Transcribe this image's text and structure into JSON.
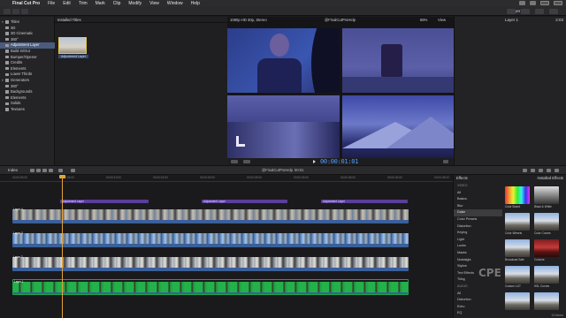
{
  "menubar": {
    "app_name": "Final Cut Pro",
    "menus": [
      "File",
      "Edit",
      "Trim",
      "Mark",
      "Clip",
      "Modify",
      "View",
      "Window",
      "Help"
    ]
  },
  "toolbar": {
    "right_label": "Layer 1"
  },
  "sidebar": {
    "items": [
      {
        "label": "Titles",
        "level": 0,
        "expanded": true,
        "selected": false
      },
      {
        "label": "3D",
        "level": 1,
        "selected": false
      },
      {
        "label": "3D Cinematic",
        "level": 1,
        "selected": false
      },
      {
        "label": "360°",
        "level": 1,
        "selected": false
      },
      {
        "label": "Adjustment Layer",
        "level": 1,
        "selected": true
      },
      {
        "label": "Build In/Out",
        "level": 1,
        "selected": false
      },
      {
        "label": "Bumper/Opener",
        "level": 1,
        "selected": false
      },
      {
        "label": "Credits",
        "level": 1,
        "selected": false
      },
      {
        "label": "Elements",
        "level": 1,
        "selected": false
      },
      {
        "label": "Lower Thirds",
        "level": 1,
        "selected": false
      },
      {
        "label": "Generators",
        "level": 0,
        "expanded": true,
        "selected": false
      },
      {
        "label": "360°",
        "level": 1,
        "selected": false
      },
      {
        "label": "Backgrounds",
        "level": 1,
        "selected": false
      },
      {
        "label": "Elements",
        "level": 1,
        "selected": false
      },
      {
        "label": "Solids",
        "level": 1,
        "selected": false
      },
      {
        "label": "Textures",
        "level": 1,
        "selected": false
      }
    ]
  },
  "browser": {
    "header": "Installed Titles",
    "clip_label": "Adjustment Layer"
  },
  "viewer": {
    "format": "1080p HD 30p, Stereo",
    "title": "@FinalCutProHelp",
    "zoom": "66%",
    "view_label": "View",
    "timecode": "00:00:01:01"
  },
  "inspector": {
    "title": "Layer 1",
    "time": "2:03"
  },
  "timeline_bar": {
    "index_label": "Index",
    "project": "@FinalCutProHelp",
    "duration": "00:01"
  },
  "timeline": {
    "ruler_ticks": [
      "00:00:00:00",
      "00:00:05:00",
      "00:00:10:00",
      "00:00:15:00",
      "00:00:20:00",
      "00:00:25:00",
      "00:00:30:00",
      "00:00:35:00",
      "00:00:40:00",
      "00:00:45:00",
      "00:00:50:00"
    ],
    "adjustment_clips": [
      "Adjustment Layer",
      "Adjustment Layer",
      "Adjustment Layer"
    ],
    "tracks": [
      {
        "name": "Layer 4",
        "style": "t-blue"
      },
      {
        "name": "Layer 3",
        "style": "t-mtn"
      },
      {
        "name": "Layer 2",
        "style": "t-car"
      },
      {
        "name": "Layer 1",
        "style": "t-green"
      }
    ]
  },
  "effects": {
    "categories_header": "Effects",
    "installed_header": "Installed Effects",
    "categories": [
      {
        "label": "VIDEO",
        "header": true
      },
      {
        "label": "All",
        "selected": false
      },
      {
        "label": "Basics",
        "selected": false
      },
      {
        "label": "Blur",
        "selected": false
      },
      {
        "label": "Color",
        "selected": true
      },
      {
        "label": "Color Presets",
        "selected": false
      },
      {
        "label": "Distortion",
        "selected": false
      },
      {
        "label": "Keying",
        "selected": false
      },
      {
        "label": "Light",
        "selected": false
      },
      {
        "label": "Looks",
        "selected": false
      },
      {
        "label": "Masks",
        "selected": false
      },
      {
        "label": "Nostalgia",
        "selected": false
      },
      {
        "label": "Stylize",
        "selected": false
      },
      {
        "label": "Text Effects",
        "selected": false
      },
      {
        "label": "Tiling",
        "selected": false
      },
      {
        "label": "AUDIO",
        "header": true
      },
      {
        "label": "All",
        "selected": false
      },
      {
        "label": "Distortion",
        "selected": false
      },
      {
        "label": "Echo",
        "selected": false
      },
      {
        "label": "EQ",
        "selected": false
      }
    ],
    "tiles": [
      {
        "label": "Color Board",
        "kind": "board"
      },
      {
        "label": "Black & White",
        "kind": "bw"
      },
      {
        "label": "Color Wheels",
        "kind": "mtn"
      },
      {
        "label": "Color Curves",
        "kind": "mtn"
      },
      {
        "label": "Broadcast Safe",
        "kind": "mtn"
      },
      {
        "label": "Colorize",
        "kind": "red"
      },
      {
        "label": "Custom LUT",
        "kind": "mtn"
      },
      {
        "label": "HSL Curves",
        "kind": "mtn"
      },
      {
        "label": "",
        "kind": "mtn"
      },
      {
        "label": "",
        "kind": "mtn"
      }
    ],
    "watermark": "CPE",
    "footer": "13 items"
  }
}
